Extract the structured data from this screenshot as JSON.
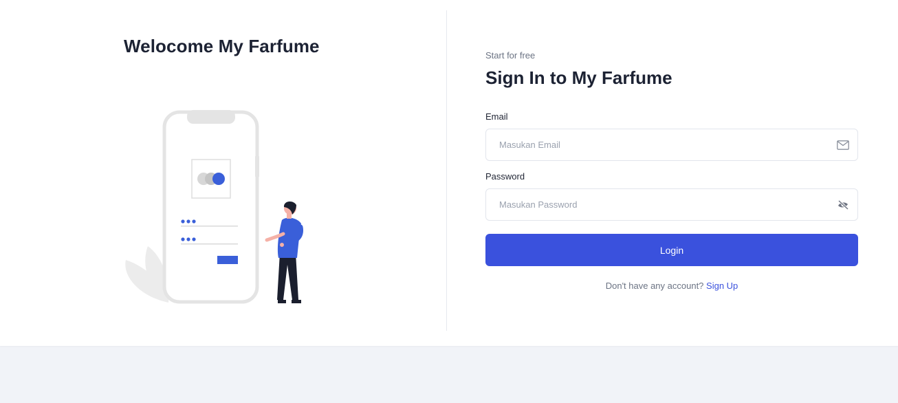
{
  "colors": {
    "accent": "#3a51dd",
    "page_background": "#f1f3f8",
    "card_background": "#ffffff",
    "illustration_shirt": "#3a5fd9"
  },
  "left": {
    "title": "Welocome My Farfume",
    "illustration": "phone-login-person-illustration"
  },
  "form": {
    "eyebrow": "Start for free",
    "title": "Sign In to My Farfume",
    "email": {
      "label": "Email",
      "placeholder": "Masukan Email",
      "value": "",
      "icon": "mail-icon"
    },
    "password": {
      "label": "Password",
      "placeholder": "Masukan Password",
      "value": "",
      "icon": "eye-slash-icon"
    },
    "login_label": "Login",
    "signup_prompt": "Don't have any account?",
    "signup_link": "Sign Up"
  }
}
